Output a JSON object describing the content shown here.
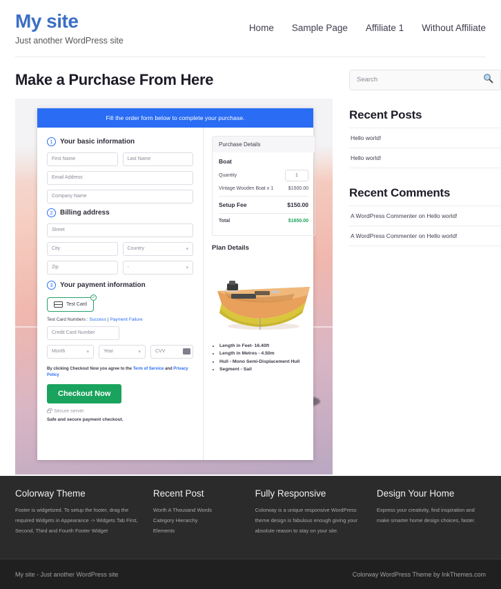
{
  "header": {
    "brand_title": "My site",
    "tagline": "Just another WordPress site",
    "nav": [
      {
        "label": "Home"
      },
      {
        "label": "Sample Page"
      },
      {
        "label": "Affiliate 1"
      },
      {
        "label": "Without Affiliate"
      }
    ]
  },
  "main": {
    "page_title": "Make a Purchase From Here",
    "checkout": {
      "banner": "Fill the order form below to complete your purchase.",
      "step1": {
        "num": "1",
        "label": "Your basic information",
        "first_name_placeholder": "First Name",
        "last_name_placeholder": "Last Name",
        "email_placeholder": "Email Address",
        "company_placeholder": "Company Name"
      },
      "step2": {
        "num": "2",
        "label": "Billing address",
        "street_placeholder": "Street",
        "city_placeholder": "City",
        "country_placeholder": "Country",
        "zip_placeholder": "Zip",
        "state_placeholder": "-"
      },
      "step3": {
        "num": "3",
        "label": "Your payment information",
        "test_card_label": "Test  Card",
        "test_card_numbers_prefix": "Test Card Numbers : ",
        "success_link": "Success",
        "separator": " | ",
        "failure_link": "Payment Failure",
        "card_number_placeholder": "Credit Card Number",
        "month_placeholder": "Month",
        "year_placeholder": "Year",
        "cvv_placeholder": "CVV",
        "terms_prefix": "By clicking Checkout Now you agree to the ",
        "terms_link": "Term of Service",
        "terms_and": " and ",
        "privacy_link": "Privacy Policy",
        "checkout_button": "Checkout Now",
        "secure_server": "Secure server",
        "safe_note": "Safe and secure payment checkout."
      },
      "purchase_details": {
        "heading": "Purchase Details",
        "product": "Boat",
        "quantity_label": "Quantity",
        "quantity_value": "1",
        "line_item_label": "Vintage Wooden Boat x 1",
        "line_item_price": "$1500.00",
        "setup_fee_label": "Setup Fee",
        "setup_fee_price": "$150.00",
        "total_label": "Total",
        "total_price": "$1650.00"
      },
      "plan_details": {
        "heading": "Plan Details",
        "specs": [
          "Length in Feet- 16.40ft",
          "Length in Metres - 4.50m",
          "Hull - Mono Semi-Displacement Hull",
          "Segment - Sail"
        ]
      }
    }
  },
  "sidebar": {
    "search_placeholder": "Search",
    "recent_posts_title": "Recent Posts",
    "recent_posts": [
      "Hello world!",
      "Hello world!"
    ],
    "recent_comments_title": "Recent Comments",
    "recent_comments": [
      "A WordPress Commenter on Hello world!",
      "A WordPress Commenter on Hello world!"
    ]
  },
  "footer": {
    "columns": [
      {
        "title": "Colorway Theme",
        "text": "Footer is widgetized. To setup the footer, drag the required Widgets in Appearance -> Widgets Tab First, Second, Third and Fourth Footer Widget"
      },
      {
        "title": "Recent Post",
        "items": [
          "Worth A Thousand Words",
          "Category Hierarchy",
          "Elements"
        ]
      },
      {
        "title": "Fully Responsive",
        "text": "Colorway is a unique responsive WordPress theme design is fabulous enough giving your absolute reason to stay on your site."
      },
      {
        "title": "Design Your Home",
        "text": "Express your creativity, find inspiration and make smarter home design choices, faster."
      }
    ],
    "copyright_left": "My site - Just another WordPress site",
    "copyright_right": "Colorway WordPress Theme by InkThemes.com"
  },
  "colors": {
    "brand_blue": "#3b6fc4",
    "banner_blue": "#2a6df4",
    "success_green": "#1aa35c",
    "footer_dark": "#2b2b2b"
  }
}
